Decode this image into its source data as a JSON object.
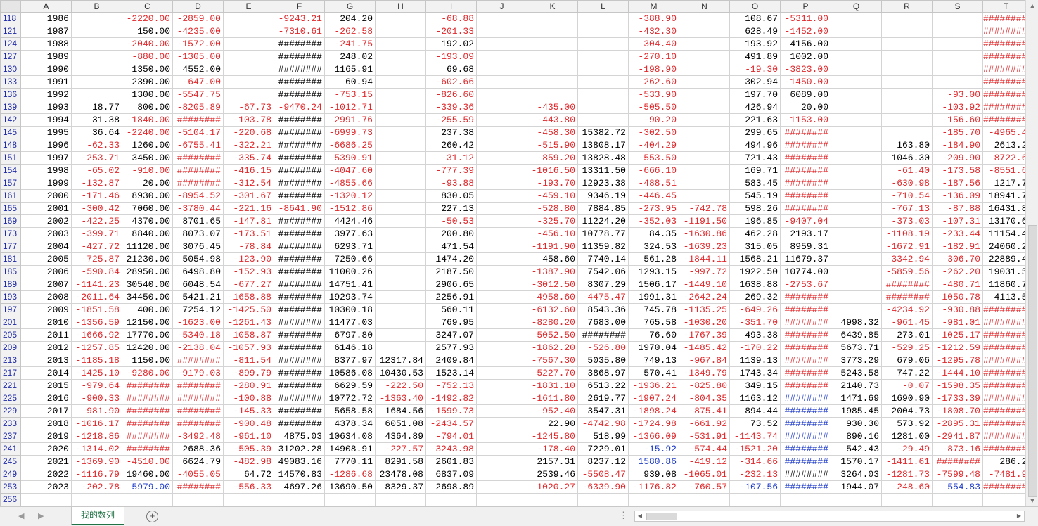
{
  "columns": [
    "A",
    "B",
    "C",
    "D",
    "E",
    "F",
    "G",
    "H",
    "I",
    "J",
    "K",
    "L",
    "M",
    "N",
    "O",
    "P",
    "Q",
    "R",
    "S",
    "T"
  ],
  "rows": [
    [
      "118",
      "1986",
      "",
      "-2220.00",
      "-2859.00",
      "",
      "-9243.21",
      "204.20",
      "",
      "-68.88",
      "",
      "",
      "",
      "-388.90",
      "",
      "108.67",
      "-5311.00",
      "",
      "",
      "",
      "########"
    ],
    [
      "121",
      "1987",
      "",
      "150.00",
      "-4235.00",
      "",
      "-7310.61",
      "-262.58",
      "",
      "-201.33",
      "",
      "",
      "",
      "-432.30",
      "",
      "628.49",
      "-1452.00",
      "",
      "",
      "",
      "########"
    ],
    [
      "124",
      "1988",
      "",
      "-2040.00",
      "-1572.00",
      "",
      "########",
      "-241.75",
      "",
      "192.02",
      "",
      "",
      "",
      "-304.40",
      "",
      "193.92",
      "4156.00",
      "",
      "",
      "",
      "########"
    ],
    [
      "127",
      "1989",
      "",
      "-880.00",
      "-1305.00",
      "",
      "########",
      "248.02",
      "",
      "-193.09",
      "",
      "",
      "",
      "-270.10",
      "",
      "491.89",
      "1002.00",
      "",
      "",
      "",
      "########"
    ],
    [
      "130",
      "1990",
      "",
      "1350.00",
      "4552.00",
      "",
      "########",
      "1165.91",
      "",
      "69.68",
      "",
      "",
      "",
      "-198.90",
      "",
      "-19.30",
      "-3823.00",
      "",
      "",
      "",
      "########"
    ],
    [
      "133",
      "1991",
      "",
      "2390.00",
      "-647.00",
      "",
      "########",
      "60.94",
      "",
      "-602.66",
      "",
      "",
      "",
      "-262.60",
      "",
      "302.94",
      "-1450.00",
      "",
      "",
      "",
      "########"
    ],
    [
      "136",
      "1992",
      "",
      "1300.00",
      "-5547.75",
      "",
      "########",
      "-753.15",
      "",
      "-826.60",
      "",
      "",
      "",
      "-533.90",
      "",
      "197.70",
      "6089.00",
      "",
      "",
      "-93.00",
      "########"
    ],
    [
      "139",
      "1993",
      "18.77",
      "800.00",
      "-8205.89",
      "-67.73",
      "-9470.24",
      "-1012.71",
      "",
      "-339.36",
      "",
      "-435.00",
      "",
      "-505.50",
      "",
      "426.94",
      "20.00",
      "",
      "",
      "-103.92",
      "########"
    ],
    [
      "142",
      "1994",
      "31.38",
      "-1840.00",
      "########",
      "-103.78",
      "########",
      "-2991.76",
      "",
      "-255.59",
      "",
      "-443.80",
      "",
      "-90.20",
      "",
      "221.63",
      "-1153.00",
      "",
      "",
      "-156.60",
      "########"
    ],
    [
      "145",
      "1995",
      "36.64",
      "-2240.00",
      "-5104.17",
      "-220.68",
      "########",
      "-6999.73",
      "",
      "237.38",
      "",
      "-458.30",
      "15382.72",
      "-302.50",
      "",
      "299.65",
      "########",
      "",
      "",
      "-185.70",
      "-4965.4"
    ],
    [
      "148",
      "1996",
      "-62.33",
      "1260.00",
      "-6755.41",
      "-322.21",
      "########",
      "-6686.25",
      "",
      "260.42",
      "",
      "-515.90",
      "13808.17",
      "-404.29",
      "",
      "494.96",
      "########",
      "",
      "163.80",
      "-184.90",
      "2613.2"
    ],
    [
      "151",
      "1997",
      "-253.71",
      "3450.00",
      "########",
      "-335.74",
      "########",
      "-5390.91",
      "",
      "-31.12",
      "",
      "-859.20",
      "13828.48",
      "-553.50",
      "",
      "721.43",
      "########",
      "",
      "1046.30",
      "-209.90",
      "-8722.6"
    ],
    [
      "154",
      "1998",
      "-65.02",
      "-910.00",
      "########",
      "-416.15",
      "########",
      "-4047.60",
      "",
      "-777.39",
      "",
      "-1016.50",
      "13311.50",
      "-666.10",
      "",
      "169.71",
      "########",
      "",
      "-61.40",
      "-173.58",
      "-8551.6"
    ],
    [
      "157",
      "1999",
      "-132.87",
      "20.00",
      "########",
      "-312.54",
      "########",
      "-4855.66",
      "",
      "-93.88",
      "",
      "-193.70",
      "12923.38",
      "-488.51",
      "",
      "583.45",
      "########",
      "",
      "-630.98",
      "-187.56",
      "1217.7"
    ],
    [
      "161",
      "2000",
      "-171.46",
      "8930.00",
      "-8954.52",
      "-301.67",
      "########",
      "-1320.12",
      "",
      "830.05",
      "",
      "-459.10",
      "9346.19",
      "-446.45",
      "",
      "545.19",
      "########",
      "",
      "-710.54",
      "-136.09",
      "18941.7"
    ],
    [
      "165",
      "2001",
      "-300.42",
      "7060.00",
      "-3780.44",
      "-221.16",
      "-8641.90",
      "-1512.86",
      "",
      "227.13",
      "",
      "-528.80",
      "7884.85",
      "-273.95",
      "-742.78",
      "598.26",
      "########",
      "",
      "-767.13",
      "-87.88",
      "16431.8"
    ],
    [
      "169",
      "2002",
      "-422.25",
      "4370.00",
      "8701.65",
      "-147.81",
      "########",
      "4424.46",
      "",
      "-50.53",
      "",
      "-325.70",
      "11224.20",
      "-352.03",
      "-1191.50",
      "196.85",
      "-9407.04",
      "",
      "-373.03",
      "-107.31",
      "13170.6"
    ],
    [
      "173",
      "2003",
      "-399.71",
      "8840.00",
      "8073.07",
      "-173.51",
      "########",
      "3977.63",
      "",
      "200.80",
      "",
      "-456.10",
      "10778.77",
      "84.35",
      "-1630.86",
      "462.28",
      "2193.17",
      "",
      "-1108.19",
      "-233.44",
      "11154.4"
    ],
    [
      "177",
      "2004",
      "-427.72",
      "11120.00",
      "3076.45",
      "-78.84",
      "########",
      "6293.71",
      "",
      "471.54",
      "",
      "-1191.90",
      "11359.82",
      "324.53",
      "-1639.23",
      "315.05",
      "8959.31",
      "",
      "-1672.91",
      "-182.91",
      "24060.2"
    ],
    [
      "181",
      "2005",
      "-725.87",
      "21230.00",
      "5054.98",
      "-123.90",
      "########",
      "7250.66",
      "",
      "1474.20",
      "",
      "458.60",
      "7740.14",
      "561.28",
      "-1844.11",
      "1568.21",
      "11679.37",
      "",
      "-3342.94",
      "-306.70",
      "22889.4"
    ],
    [
      "185",
      "2006",
      "-590.84",
      "28950.00",
      "6498.80",
      "-152.93",
      "########",
      "11000.26",
      "",
      "2187.50",
      "",
      "-1387.90",
      "7542.06",
      "1293.15",
      "-997.72",
      "1922.50",
      "10774.00",
      "",
      "-5859.56",
      "-262.20",
      "19031.5"
    ],
    [
      "189",
      "2007",
      "-1141.23",
      "30540.00",
      "6048.54",
      "-677.27",
      "########",
      "14751.41",
      "",
      "2906.65",
      "",
      "-3012.50",
      "8307.29",
      "1506.17",
      "-1449.10",
      "1638.88",
      "-2753.67",
      "",
      "########",
      "-480.71",
      "11860.7"
    ],
    [
      "193",
      "2008",
      "-2011.64",
      "34450.00",
      "5421.21",
      "-1658.88",
      "########",
      "19293.74",
      "",
      "2256.91",
      "",
      "-4958.60",
      "-4475.47",
      "1991.31",
      "-2642.24",
      "269.32",
      "########",
      "",
      "########",
      "-1050.78",
      "4113.5"
    ],
    [
      "197",
      "2009",
      "-1851.58",
      "400.00",
      "7254.12",
      "-1425.50",
      "########",
      "10300.18",
      "",
      "560.11",
      "",
      "-6132.60",
      "8543.36",
      "745.78",
      "-1135.25",
      "-649.26",
      "########",
      "",
      "-4234.92",
      "-930.88",
      "########"
    ],
    [
      "201",
      "2010",
      "-1356.59",
      "12150.00",
      "-1623.00",
      "-1261.43",
      "########",
      "11477.03",
      "",
      "769.95",
      "",
      "-8280.20",
      "7683.00",
      "765.58",
      "-1030.20",
      "-351.70",
      "########",
      "4998.32",
      "-961.45",
      "-981.01",
      "########"
    ],
    [
      "205",
      "2011",
      "-1666.92",
      "17770.00",
      "-5340.18",
      "-1058.87",
      "########",
      "6797.80",
      "",
      "3247.07",
      "",
      "-5052.50",
      "########",
      "76.60",
      "-1767.39",
      "493.38",
      "########",
      "6439.85",
      "273.01",
      "-1025.17",
      "########"
    ],
    [
      "209",
      "2012",
      "-1257.85",
      "12420.00",
      "-2138.04",
      "-1057.93",
      "########",
      "6146.18",
      "",
      "2577.93",
      "",
      "-1862.20",
      "-526.80",
      "1970.04",
      "-1485.42",
      "-170.22",
      "########",
      "5673.71",
      "-529.25",
      "-1212.59",
      "########"
    ],
    [
      "213",
      "2013",
      "-1185.18",
      "1150.00",
      "########",
      "-811.54",
      "########",
      "8377.97",
      "12317.84",
      "2409.84",
      "",
      "-7567.30",
      "5035.80",
      "749.13",
      "-967.84",
      "1139.13",
      "########",
      "3773.29",
      "679.06",
      "-1295.78",
      "########"
    ],
    [
      "217",
      "2014",
      "-1425.10",
      "-9280.00",
      "-9179.03",
      "-899.79",
      "########",
      "10586.08",
      "10430.53",
      "1523.14",
      "",
      "-5227.70",
      "3868.97",
      "570.41",
      "-1349.79",
      "1743.34",
      "########",
      "5243.58",
      "747.22",
      "-1444.10",
      "########"
    ],
    [
      "221",
      "2015",
      "-979.64",
      "########",
      "########",
      "-280.91",
      "########",
      "6629.59",
      "-222.50",
      "-752.13",
      "",
      "-1831.10",
      "6513.22",
      "-1936.21",
      "-825.80",
      "349.15",
      "########",
      "2140.73",
      "-0.07",
      "-1598.35",
      "########"
    ],
    [
      "225",
      "2016",
      "-900.33",
      "########",
      "########",
      "-100.88",
      "########",
      "10772.72",
      "-1363.40",
      "-1492.82",
      "",
      "-1611.80",
      "2619.77",
      "-1907.24",
      "-804.35",
      "1163.12",
      "########",
      "1471.69",
      "1690.90",
      "-1733.39",
      "########"
    ],
    [
      "229",
      "2017",
      "-981.90",
      "########",
      "########",
      "-145.33",
      "########",
      "5658.58",
      "1684.56",
      "-1599.73",
      "",
      "-952.40",
      "3547.31",
      "-1898.24",
      "-875.41",
      "894.44",
      "########",
      "1985.45",
      "2004.73",
      "-1808.70",
      "########"
    ],
    [
      "233",
      "2018",
      "-1016.17",
      "########",
      "########",
      "-900.48",
      "########",
      "4378.34",
      "6051.08",
      "-2434.57",
      "",
      "22.90",
      "-4742.98",
      "-1724.98",
      "-661.92",
      "73.52",
      "########",
      "930.30",
      "573.92",
      "-2895.31",
      "########"
    ],
    [
      "237",
      "2019",
      "-1218.86",
      "########",
      "-3492.48",
      "-961.10",
      "4875.03",
      "10634.08",
      "4364.89",
      "-794.01",
      "",
      "-1245.80",
      "518.99",
      "-1366.09",
      "-531.91",
      "-1143.74",
      "########",
      "890.16",
      "1281.00",
      "-2941.87",
      "########"
    ],
    [
      "241",
      "2020",
      "-1314.02",
      "########",
      "2688.36",
      "-505.39",
      "31202.28",
      "14908.91",
      "-227.57",
      "-3243.98",
      "",
      "-178.40",
      "7229.01",
      "-15.92",
      "-574.44",
      "-1521.20",
      "########",
      "542.43",
      "-29.49",
      "-873.16",
      "########"
    ],
    [
      "245",
      "2021",
      "-1369.90",
      "-4510.00",
      "6624.79",
      "-482.98",
      "49083.16",
      "7770.11",
      "8291.58",
      "2601.83",
      "",
      "2157.31",
      "8237.12",
      "1580.86",
      "-419.12",
      "-314.66",
      "########",
      "1570.17",
      "-1411.61",
      "########",
      "286.2"
    ],
    [
      "249",
      "2022",
      "-1116.79",
      "19460.00",
      "-4055.05",
      "64.72",
      "14570.83",
      "-1286.68",
      "23478.08",
      "6837.09",
      "",
      "2539.46",
      "-5508.47",
      "939.08",
      "-1065.01",
      "-232.13",
      "########",
      "3264.03",
      "-1281.73",
      "-7599.48",
      "-7481.9"
    ],
    [
      "253",
      "2023",
      "-202.78",
      "5979.00",
      "########",
      "-556.33",
      "4697.26",
      "13690.50",
      "8329.37",
      "2698.89",
      "",
      "-1020.27",
      "-6339.90",
      "-1176.82",
      "-760.57",
      "-107.56",
      "########",
      "1944.07",
      "-248.60",
      "554.83",
      "########"
    ],
    [
      "256",
      "",
      "",
      "",
      "",
      "",
      "",
      "",
      "",
      "",
      "",
      "",
      "",
      "",
      "",
      "",
      "",
      "",
      "",
      "",
      ""
    ]
  ],
  "color_overrides": {
    "36": {
      "20": "neg"
    },
    "37": {
      "3": "blu",
      "13": "neg",
      "15": "blu",
      "16": "blu",
      "19": "blu"
    },
    "35": {
      "13": "blu",
      "16": "blu"
    },
    "31": {
      "16": "blu"
    },
    "32": {
      "16": "blu"
    },
    "33": {
      "16": "blu"
    },
    "34": {
      "13": "blu",
      "16": "blu"
    },
    "30": {
      "16": "blu"
    }
  },
  "neg_hash_cells": {
    "0": [
      20
    ],
    "1": [
      20
    ],
    "2": [
      5,
      20
    ],
    "3": [
      5,
      20
    ],
    "4": [
      5,
      20
    ],
    "5": [
      5,
      20
    ],
    "6": [
      5,
      20
    ],
    "7": [
      20
    ],
    "8": [
      4,
      5,
      20
    ],
    "9": [
      5,
      16
    ],
    "10": [
      5,
      16
    ],
    "11": [
      4,
      5,
      16
    ],
    "12": [
      4,
      5,
      16
    ],
    "13": [
      4,
      5,
      16
    ],
    "14": [
      5,
      16
    ],
    "15": [
      16
    ],
    "16": [
      5
    ],
    "17": [
      5
    ],
    "18": [
      5
    ],
    "19": [
      5
    ],
    "20": [
      5
    ],
    "21": [
      5,
      18
    ],
    "22": [
      5,
      16,
      18
    ],
    "23": [
      5,
      16,
      20
    ],
    "24": [
      5,
      16,
      20
    ],
    "25": [
      5,
      11,
      16,
      20
    ],
    "26": [
      5,
      16,
      20
    ],
    "27": [
      4,
      5,
      16,
      20
    ],
    "28": [
      5,
      16,
      20
    ],
    "29": [
      3,
      4,
      5,
      16,
      20
    ],
    "30": [
      3,
      4,
      5,
      20
    ],
    "31": [
      3,
      4,
      5,
      20
    ],
    "32": [
      3,
      4,
      5,
      20
    ],
    "33": [
      3,
      20
    ],
    "34": [
      3,
      20
    ],
    "35": [
      19
    ],
    "36": [],
    "37": [
      4,
      20
    ]
  },
  "sheet_tab": "我的数列",
  "add_sheet_symbol": "+",
  "dots_symbol": "⋮",
  "nav_prev": "◀",
  "nav_next": "▶",
  "scroll_up": "▲",
  "scroll_down": "▼",
  "scroll_left": "◀",
  "scroll_right": "▶"
}
